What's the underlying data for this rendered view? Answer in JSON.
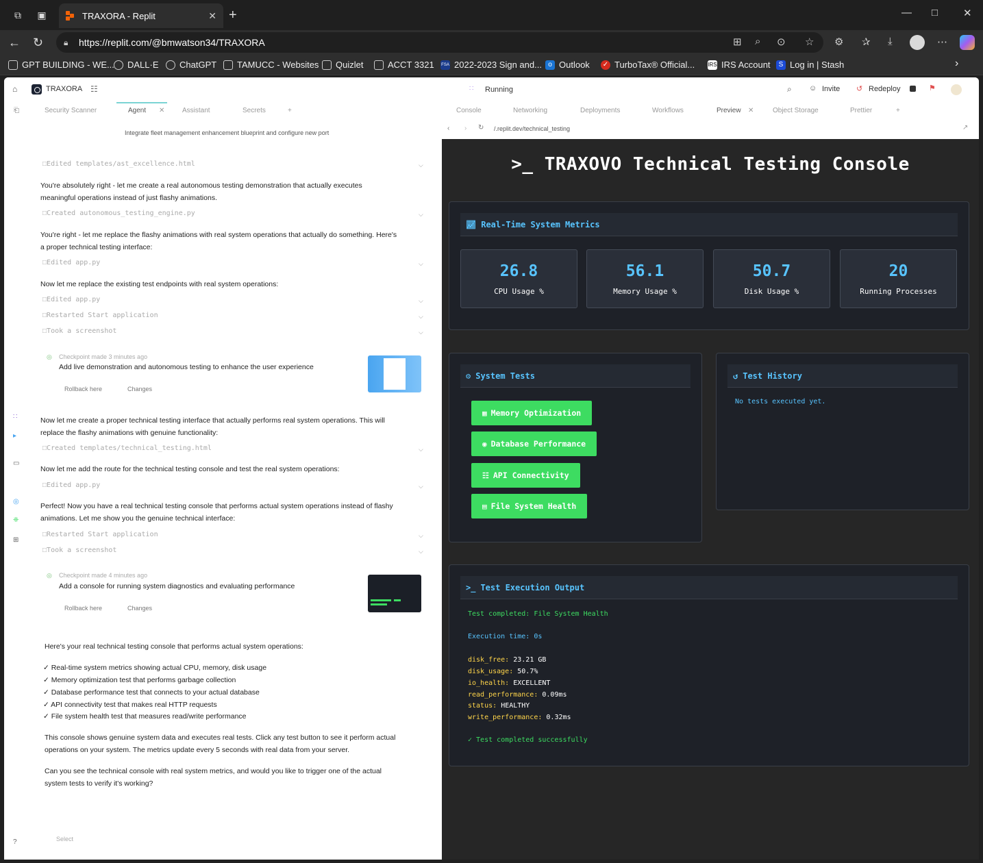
{
  "browser": {
    "tab_title": "TRAXORA - Replit",
    "url": "https://replit.com/@bmwatson34/TRAXORA",
    "bookmarks": [
      {
        "label": "GPT BUILDING - WE..."
      },
      {
        "label": "DALL·E"
      },
      {
        "label": "ChatGPT"
      },
      {
        "label": "TAMUCC - Websites"
      },
      {
        "label": "Quizlet"
      },
      {
        "label": "ACCT 3321"
      },
      {
        "label": "2022-2023 Sign and..."
      },
      {
        "label": "Outlook"
      },
      {
        "label": "TurboTax® Official..."
      },
      {
        "label": "IRS Account"
      },
      {
        "label": "Log in | Stash"
      }
    ]
  },
  "replit": {
    "project_name": "TRAXORA",
    "status": "Running",
    "invite_label": "Invite",
    "redeploy_label": "Redeploy",
    "left_tabs": [
      "Security Scanner",
      "Agent",
      "Assistant",
      "Secrets"
    ],
    "right_tabs": [
      "Console",
      "Networking",
      "Deployments",
      "Workflows",
      "Preview",
      "Object Storage",
      "Prettier"
    ],
    "preview_url": "/.replit.dev/technical_testing"
  },
  "chat": {
    "header": "Integrate fleet management enhancement blueprint and configure new port",
    "items": [
      {
        "kind": "edit",
        "text": "Edited templates/ast_excellence.html"
      },
      {
        "kind": "text",
        "text": "You're absolutely right - let me create a real autonomous testing demonstration that actually executes"
      },
      {
        "kind": "text",
        "text": "meaningful operations instead of just flashy animations."
      },
      {
        "kind": "edit",
        "text": "Created autonomous_testing_engine.py"
      },
      {
        "kind": "text",
        "text": "You're right - let me replace the flashy animations with real system operations that actually do something. Here's"
      },
      {
        "kind": "text",
        "text": "a proper technical testing interface:"
      },
      {
        "kind": "edit",
        "text": "Edited app.py"
      },
      {
        "kind": "text",
        "text": "Now let me replace the existing test endpoints with real system operations:"
      },
      {
        "kind": "edit",
        "text": "Edited app.py"
      },
      {
        "kind": "edit",
        "text": "Restarted Start application"
      },
      {
        "kind": "edit",
        "text": "Took a screenshot"
      }
    ],
    "checkpoint1": {
      "meta": "Checkpoint made 3 minutes ago",
      "title": "Add live demonstration and autonomous testing to enhance the user experience",
      "rollback": "Rollback here",
      "changes": "Changes"
    },
    "items2": [
      {
        "kind": "text",
        "text": "Now let me create a proper technical testing interface that actually performs real system operations. This will"
      },
      {
        "kind": "text",
        "text": "replace the flashy animations with genuine functionality:"
      },
      {
        "kind": "edit",
        "text": "Created templates/technical_testing.html"
      },
      {
        "kind": "text",
        "text": "Now let me add the route for the technical testing console and test the real system operations:"
      },
      {
        "kind": "edit",
        "text": "Edited app.py"
      },
      {
        "kind": "text",
        "text": "Perfect! Now you have a real technical testing console that performs actual system operations instead of flashy"
      },
      {
        "kind": "text",
        "text": "animations. Let me show you the genuine technical interface:"
      },
      {
        "kind": "edit",
        "text": "Restarted Start application"
      },
      {
        "kind": "edit",
        "text": "Took a screenshot"
      }
    ],
    "checkpoint2": {
      "meta": "Checkpoint made 4 minutes ago",
      "title": "Add a console for running system diagnostics and evaluating performance",
      "rollback": "Rollback here",
      "changes": "Changes"
    },
    "summary": [
      "Here's your real technical testing console that performs actual system operations:",
      "✓ Real-time system metrics showing actual CPU, memory, disk usage",
      "✓ Memory optimization test that performs garbage collection",
      "✓ Database performance test that connects to your actual database",
      "✓ API connectivity test that makes real HTTP requests",
      "✓ File system health test that measures read/write performance",
      "This console shows genuine system data and executes real tests. Click any test button to see it perform actual",
      "operations on your system. The metrics update every 5 seconds with real data from your server.",
      "Can you see the technical console with real system metrics, and would you like to trigger one of the actual",
      "system tests to verify it's working?"
    ],
    "composer_placeholder": "Select"
  },
  "console": {
    "title": "TRAXOVO Technical Testing Console",
    "metrics_title": "Real-Time System Metrics",
    "metrics": [
      {
        "value": "26.8",
        "label": "CPU Usage %"
      },
      {
        "value": "56.1",
        "label": "Memory Usage %"
      },
      {
        "value": "50.7",
        "label": "Disk Usage %"
      },
      {
        "value": "20",
        "label": "Running Processes"
      }
    ],
    "tests_title": "System Tests",
    "tests": [
      {
        "label": "Memory Optimization",
        "icon": "memory-icon"
      },
      {
        "label": "Database Performance",
        "icon": "database-icon"
      },
      {
        "label": "API Connectivity",
        "icon": "network-icon"
      },
      {
        "label": "File System Health",
        "icon": "disk-icon"
      }
    ],
    "history_title": "Test History",
    "history_empty": "No tests executed yet.",
    "output_title": "Test Execution Output",
    "output": {
      "completed": "Test completed: File System Health",
      "exec_time": "Execution time: 0s",
      "rows": [
        {
          "key": "disk_free:",
          "value": "23.21 GB"
        },
        {
          "key": "disk_usage:",
          "value": "50.7%"
        },
        {
          "key": "io_health:",
          "value": "EXCELLENT"
        },
        {
          "key": "read_performance:",
          "value": "0.09ms"
        },
        {
          "key": "status:",
          "value": "HEALTHY"
        },
        {
          "key": "write_performance:",
          "value": "0.32ms"
        }
      ],
      "success": "✓ Test completed successfully"
    },
    "colors": {
      "accent": "#58c4ff",
      "button": "#3ddc61",
      "panel": "#1e2128",
      "background": "#262626"
    }
  }
}
